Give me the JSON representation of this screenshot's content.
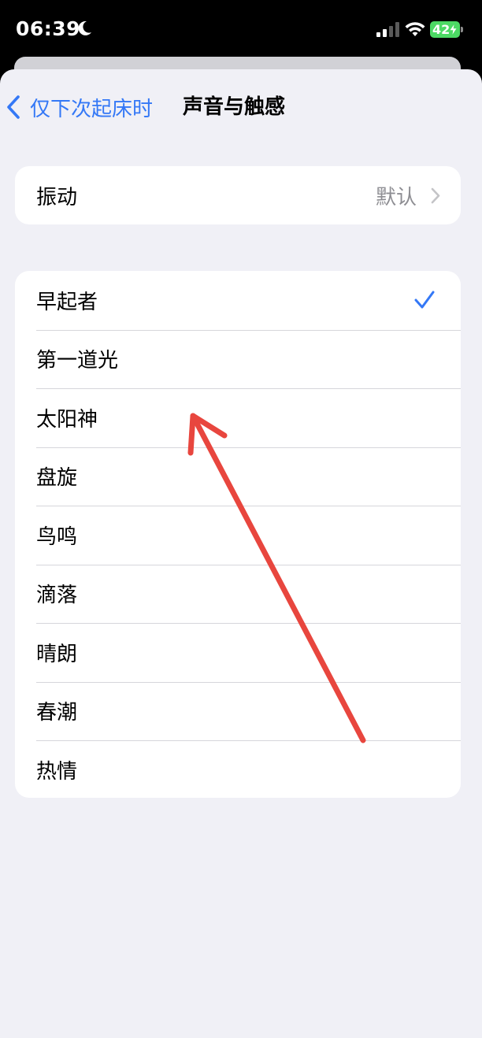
{
  "status_bar": {
    "time": "06:39",
    "battery_level": "42",
    "icons": [
      "moon-icon",
      "signal-icon",
      "wifi-icon",
      "battery-icon",
      "bolt-icon"
    ],
    "battery_color": "#4cd964"
  },
  "nav": {
    "back_label": "仅下次起床时",
    "title": "声音与触感",
    "accent_color": "#3478f6"
  },
  "vibration": {
    "label": "振动",
    "value": "默认"
  },
  "tones": {
    "items": [
      {
        "label": "早起者",
        "selected": true
      },
      {
        "label": "第一道光",
        "selected": false
      },
      {
        "label": "太阳神",
        "selected": false
      },
      {
        "label": "盘旋",
        "selected": false
      },
      {
        "label": "鸟鸣",
        "selected": false
      },
      {
        "label": "滴落",
        "selected": false
      },
      {
        "label": "晴朗",
        "selected": false
      },
      {
        "label": "春潮",
        "selected": false
      },
      {
        "label": "热情",
        "selected": false
      }
    ]
  },
  "annotation": {
    "color": "#e8463e"
  }
}
